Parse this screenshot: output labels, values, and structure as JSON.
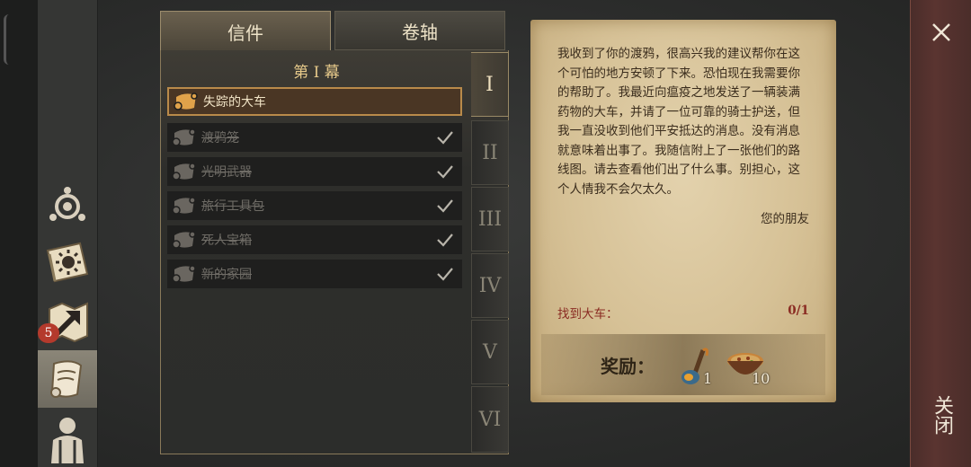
{
  "tabs": {
    "letters": "信件",
    "scrolls": "卷轴"
  },
  "act_title": "第 I 幕",
  "quests": [
    {
      "label": "失踪的大车",
      "completed": false,
      "selected": true
    },
    {
      "label": "渡鸦笼",
      "completed": true,
      "selected": false
    },
    {
      "label": "光明武器",
      "completed": true,
      "selected": false
    },
    {
      "label": "旅行工具包",
      "completed": true,
      "selected": false
    },
    {
      "label": "死人宝箱",
      "completed": true,
      "selected": false
    },
    {
      "label": "新的家园",
      "completed": true,
      "selected": false
    }
  ],
  "acts": [
    "I",
    "II",
    "III",
    "IV",
    "V",
    "VI"
  ],
  "active_act": "I",
  "letter": {
    "body": "我收到了你的渡鸦，很高兴我的建议帮你在这个可怕的地方安顿了下来。恐怕现在我需要你的帮助了。我最近向瘟疫之地发送了一辆装满药物的大车，并请了一位可靠的骑士护送，但我一直没收到他们平安抵达的消息。没有消息就意味着出事了。我随信附上了一张他们的路线图。请去查看他们出了什么事。别担心，这个人情我不会欠太久。",
    "signature": "您的朋友",
    "objective_label": "找到大车：",
    "objective_count": "0/1"
  },
  "rewards": {
    "label": "奖励：",
    "items": [
      {
        "icon": "torch-icon",
        "count": "1"
      },
      {
        "icon": "stew-bowl-icon",
        "count": "10"
      }
    ]
  },
  "sidebar": {
    "badge": "5"
  },
  "close": {
    "label": "关闭"
  },
  "colors": {
    "accent": "#e6c98a",
    "objective": "#8a2b22",
    "close_bg": "#5a3430"
  }
}
